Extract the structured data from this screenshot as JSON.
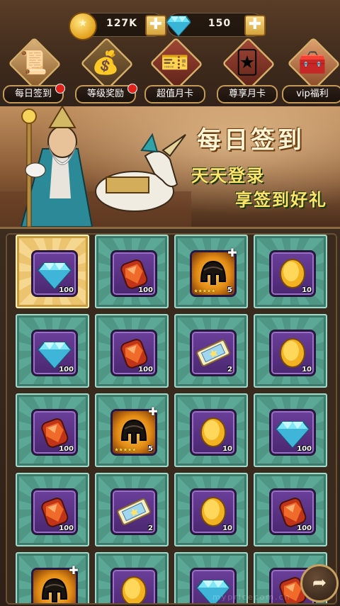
{
  "currency": {
    "gold": {
      "value": "127K",
      "icon": "gold-coin-icon"
    },
    "gems": {
      "value": "150",
      "icon": "diamond-icon"
    },
    "plus_symbol": "✚"
  },
  "menu": [
    {
      "label": "每日签到",
      "icon": "checkin-scroll-icon",
      "badge": true
    },
    {
      "label": "等级奖励",
      "icon": "coin-pile-icon",
      "badge": true
    },
    {
      "label": "超值月卡",
      "icon": "month-card-icon",
      "badge": false
    },
    {
      "label": "尊享月卡",
      "icon": "premium-card-icon",
      "badge": false
    },
    {
      "label": "vip福利",
      "icon": "treasure-chest-icon",
      "badge": false
    }
  ],
  "banner": {
    "title": "每日签到",
    "subtitle_line1": "天天登录",
    "subtitle_line2": "享签到好礼"
  },
  "rewards": [
    {
      "item": "diamond",
      "qty": "100",
      "claimed": true
    },
    {
      "item": "ruby",
      "qty": "100"
    },
    {
      "item": "helmet",
      "qty": "5",
      "stars": "★★★★★"
    },
    {
      "item": "coin",
      "qty": "10"
    },
    {
      "item": "diamond",
      "qty": "100"
    },
    {
      "item": "ruby",
      "qty": "100"
    },
    {
      "item": "ticket",
      "qty": "2"
    },
    {
      "item": "coin",
      "qty": "10"
    },
    {
      "item": "ruby",
      "qty": "100"
    },
    {
      "item": "helmet",
      "qty": "5",
      "stars": "★★★★★"
    },
    {
      "item": "coin",
      "qty": "10"
    },
    {
      "item": "diamond",
      "qty": "100"
    },
    {
      "item": "ruby",
      "qty": "100"
    },
    {
      "item": "ticket",
      "qty": "2"
    },
    {
      "item": "coin",
      "qty": "10"
    },
    {
      "item": "ruby",
      "qty": "100"
    },
    {
      "item": "helmet",
      "qty": ""
    },
    {
      "item": "coin",
      "qty": ""
    },
    {
      "item": "diamond",
      "qty": ""
    },
    {
      "item": "ruby",
      "qty": ""
    }
  ],
  "share_button": {
    "icon": "share-arrow-icon",
    "glyph": "➦"
  },
  "watermark": "mypricecom.cn",
  "colors": {
    "cell_teal": "#5ca897",
    "cell_claimed_gold": "#f5d78f",
    "slot_purple": "#6a3f9a"
  }
}
